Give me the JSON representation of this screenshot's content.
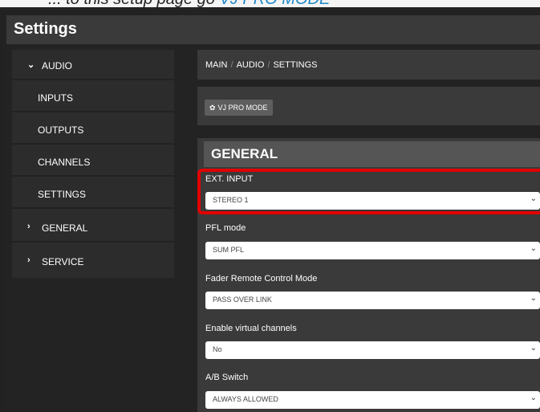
{
  "caption_fragment": "... to this setup page go",
  "caption_highlight": "VJ PRO MODE",
  "header": {
    "title": "Settings"
  },
  "sidebar": {
    "items": [
      {
        "label": "AUDIO",
        "chevron": "⌄",
        "indent": "top"
      },
      {
        "label": "INPUTS"
      },
      {
        "label": "OUTPUTS"
      },
      {
        "label": "CHANNELS"
      },
      {
        "label": "SETTINGS"
      },
      {
        "label": "GENERAL",
        "chevron": "›"
      },
      {
        "label": "SERVICE",
        "chevron": "›"
      }
    ]
  },
  "breadcrumb": {
    "items": [
      "MAIN",
      "AUDIO",
      "SETTINGS"
    ],
    "separator": "/"
  },
  "mode_button": {
    "label": "VJ PRO MODE",
    "icon": "gears-icon"
  },
  "section": {
    "title": "GENERAL"
  },
  "fields": [
    {
      "label": "EXT. INPUT",
      "value": "STEREO 1"
    },
    {
      "label": "PFL mode",
      "value": "SUM PFL"
    },
    {
      "label": "Fader Remote Control Mode",
      "value": "PASS OVER LINK"
    },
    {
      "label": "Enable virtual channels",
      "value": "No"
    },
    {
      "label": "A/B Switch",
      "value": "ALWAYS ALLOWED"
    }
  ],
  "colors": {
    "highlight": "#e00000",
    "background": "#222222",
    "panel": "#3a3a3a"
  }
}
